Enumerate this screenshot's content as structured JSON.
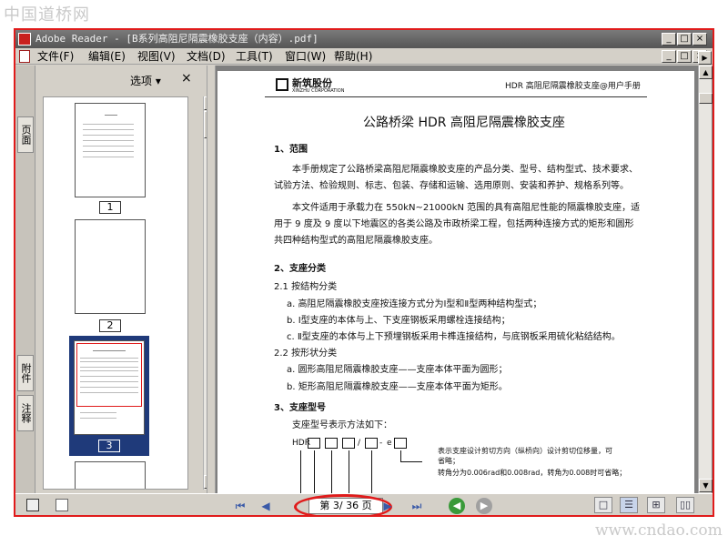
{
  "watermark": {
    "top_left": "中国道桥网",
    "bottom_right": "www.cndao.com"
  },
  "window": {
    "title": "Adobe Reader - [B系列高阻尼隔震橡胶支座（内容）.pdf]",
    "buttons": {
      "minimize": "_",
      "restore": "□",
      "close": "×"
    }
  },
  "menubar": {
    "items": [
      "文件(F)",
      "编辑(E)",
      "视图(V)",
      "文档(D)",
      "工具(T)",
      "窗口(W)",
      "帮助(H)"
    ]
  },
  "sidebar": {
    "tabs": [
      "页面",
      "附件",
      "注释"
    ],
    "options_label": "选项 ▾",
    "close_label": "×",
    "thumbnails": [
      {
        "number": "1"
      },
      {
        "number": "2"
      },
      {
        "number": "3",
        "selected": true
      }
    ]
  },
  "document": {
    "brand_name": "新筑股份",
    "brand_sub": "XINZHU CORPORATION",
    "header_right": "HDR 高阻尼隔震橡胶支座@用户手册",
    "title": "公路桥梁 HDR 高阻尼隔震橡胶支座",
    "sections": {
      "s1_heading": "1、范围",
      "s1_p1_line1": "本手册规定了公路桥梁高阻尼隔震橡胶支座的产品分类、型号、结构型式、技术要求、",
      "s1_p1_line2": "试验方法、检验规则、标志、包装、存储和运输、选用原则、安装和养护、规格系列等。",
      "s1_p2_line1": "本文件适用于承载力在 550kN~21000kN 范围的具有高阻尼性能的隔震橡胶支座，适",
      "s1_p2_line2": "用于 9 度及 9 度以下地震区的各类公路及市政桥梁工程，包括两种连接方式的矩形和圆形",
      "s1_p2_line3": "共四种结构型式的高阻尼隔震橡胶支座。",
      "s2_heading": "2、支座分类",
      "s21_heading": "2.1   按结构分类",
      "s21_a": "a.    高阻尼隔震橡胶支座按连接方式分为Ⅰ型和Ⅱ型两种结构型式；",
      "s21_b": "b.    Ⅰ型支座的本体与上、下支座钢板采用螺栓连接结构；",
      "s21_c": "c.    Ⅱ型支座的本体与上下预埋钢板采用卡榫连接结构，与底钢板采用硫化粘结结构。",
      "s22_heading": "2.2    按形状分类",
      "s22_a": "a.    圆形高阻尼隔震橡胶支座——支座本体平面为圆形；",
      "s22_b": "b.    矩形高阻尼隔震橡胶支座——支座本体平面为矩形。",
      "s3_heading": "3、支座型号",
      "s3_intro": "支座型号表示方法如下：",
      "model_prefix": "HDR",
      "model_slash": "/",
      "model_dash": "-",
      "model_e": "e",
      "note1_line1": "表示支座设计剪切方向（纵桥向）设计剪切位移量，可",
      "note1_line2": "省略；",
      "note2": "转角分为0.006rad和0.008rad，转角为0.008时可省略；"
    }
  },
  "statusbar": {
    "first": "⏮",
    "prev": "◀",
    "page_indicator": "第 3/ 36 页",
    "next": "▶",
    "last": "⏭",
    "back": "◀",
    "forward": "▶"
  },
  "colors": {
    "highlight": "#e01b1b",
    "selected_thumb": "#1f3a7a",
    "brand": "#c8201e"
  }
}
